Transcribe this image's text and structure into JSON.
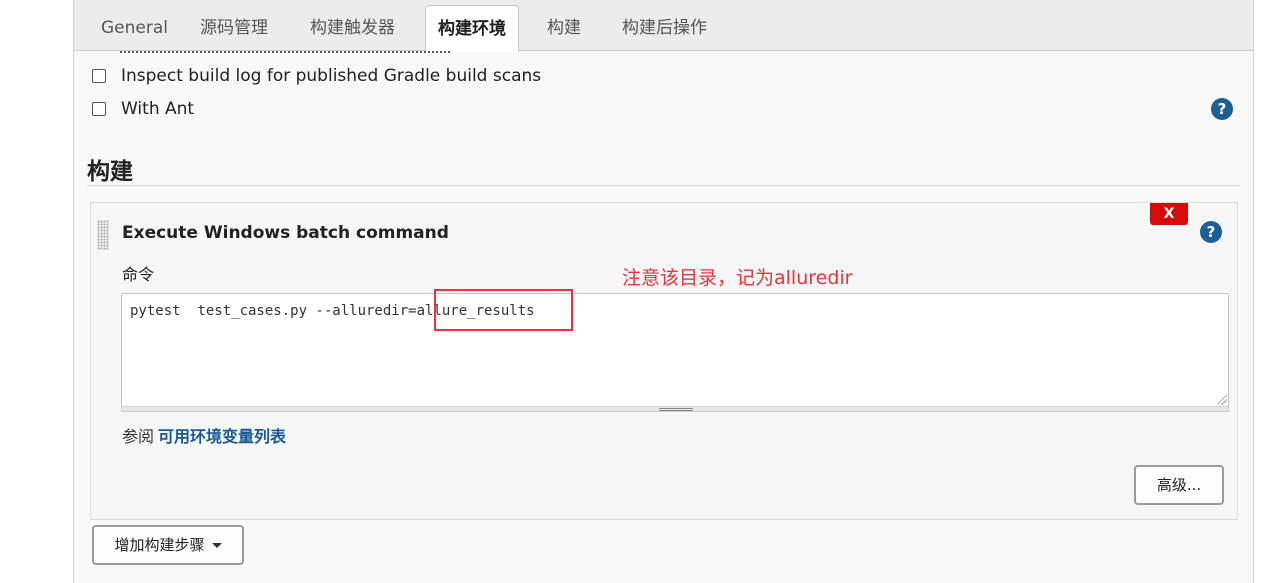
{
  "tabs": [
    {
      "label": "General",
      "active": false
    },
    {
      "label": "源码管理",
      "active": false
    },
    {
      "label": "构建触发器",
      "active": false
    },
    {
      "label": "构建环境",
      "active": true
    },
    {
      "label": "构建",
      "active": false
    },
    {
      "label": "构建后操作",
      "active": false
    }
  ],
  "build_env": {
    "options": [
      {
        "label": "Inspect build log for published Gradle build scans",
        "checked": false
      },
      {
        "label": "With Ant",
        "checked": false
      }
    ],
    "help_icon": "help-icon"
  },
  "build": {
    "section_title": "构建",
    "step": {
      "title": "Execute Windows batch command",
      "delete_label": "X",
      "command_label": "命令",
      "command_value": "pytest  test_cases.py --alluredir=allure_results",
      "see_also_prefix": "参阅",
      "env_link": "可用环境变量列表",
      "advanced_button": "高级..."
    },
    "add_step_button": "增加构建步骤"
  },
  "annotation": {
    "text": "注意该目录，记为alluredir",
    "color": "#e8343a"
  },
  "colors": {
    "delete": "#d40c0c",
    "help": "#1b5f95",
    "link": "#1a5a96"
  }
}
